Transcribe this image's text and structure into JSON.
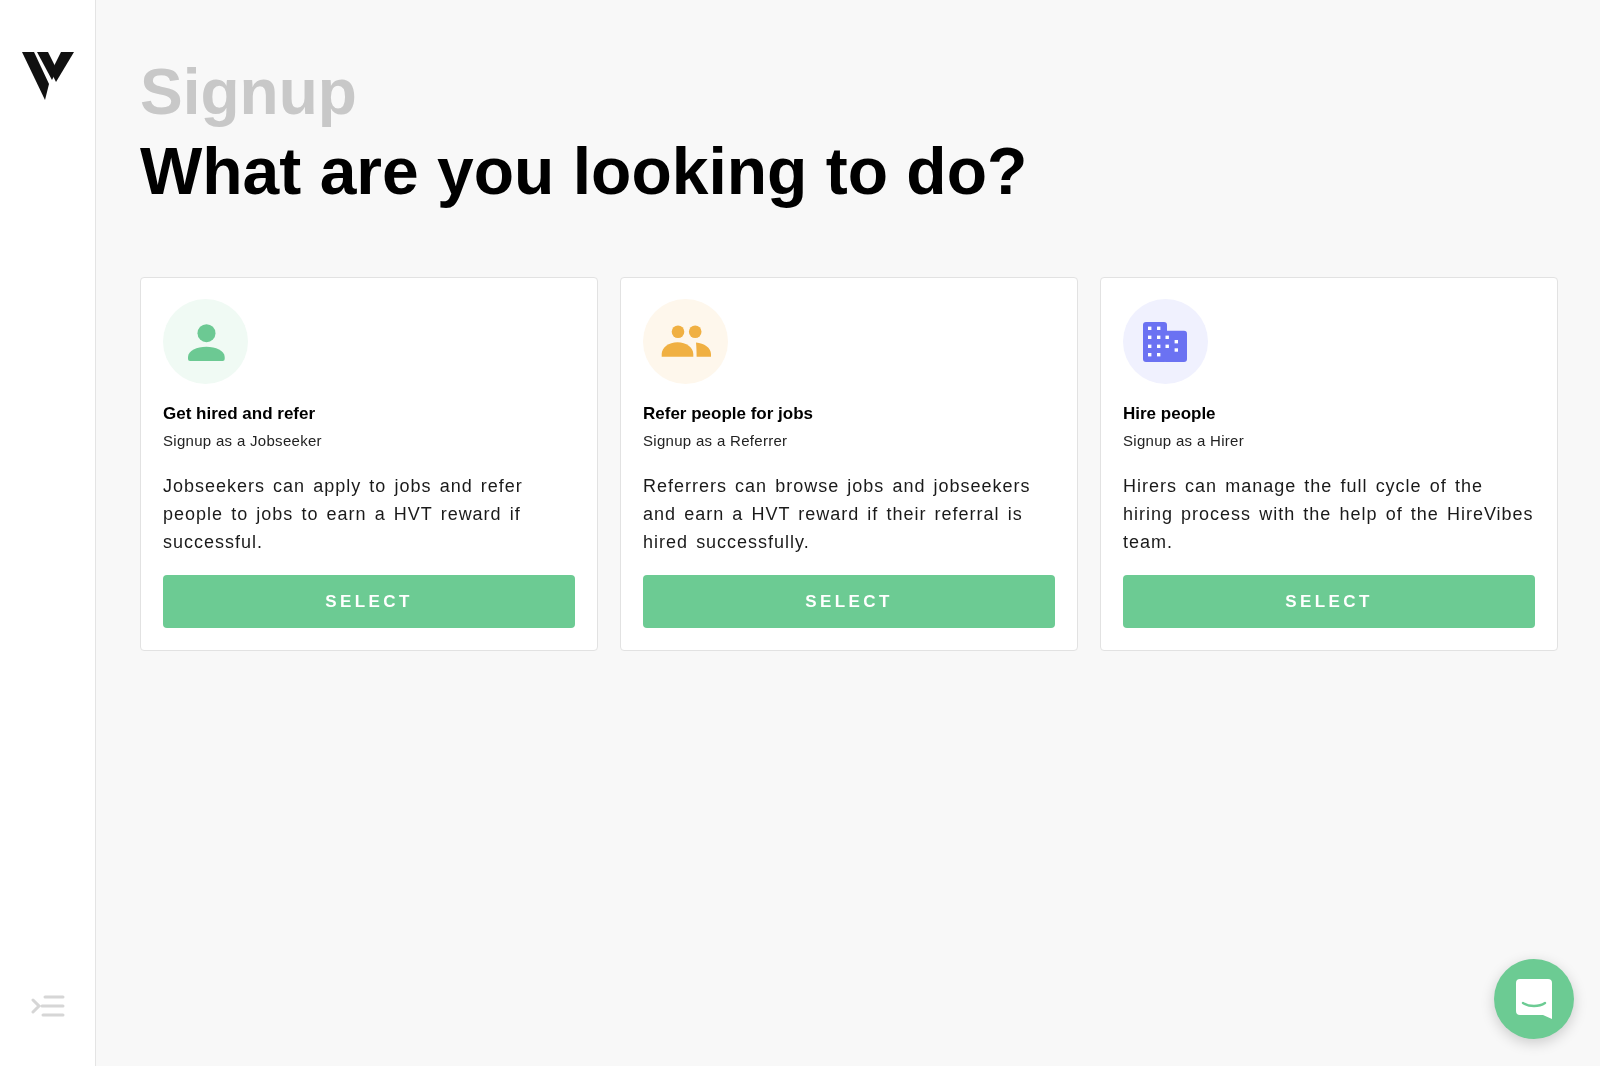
{
  "header": {
    "eyebrow": "Signup",
    "title": "What are you looking to do?"
  },
  "options": [
    {
      "kind": "person",
      "color": "#6cc993",
      "title": "Get hired and refer",
      "subtitle": "Signup as a Jobseeker",
      "description": "Jobseekers can apply to jobs and refer people to jobs to earn a HVT reward if successful.",
      "button": "SELECT"
    },
    {
      "kind": "group",
      "color": "#f0b042",
      "title": "Refer people for jobs",
      "subtitle": "Signup as a Referrer",
      "description": "Referrers can browse jobs and jobseekers and earn a HVT reward if their referral is hired successfully.",
      "button": "SELECT"
    },
    {
      "kind": "building",
      "color": "#6b72f2",
      "title": "Hire people",
      "subtitle": "Signup as a Hirer",
      "description": "Hirers can manage the full cycle of the hiring process with the help of the HireVibes team.",
      "button": "SELECT"
    }
  ]
}
